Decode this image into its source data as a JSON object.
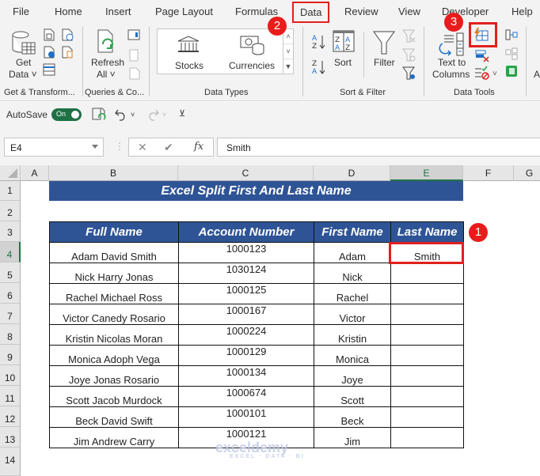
{
  "menu": {
    "tabs": [
      "File",
      "Home",
      "Insert",
      "Page Layout",
      "Formulas",
      "Data",
      "Review",
      "View",
      "Developer",
      "Help"
    ],
    "active_tab": "Data"
  },
  "ribbon": {
    "groups": {
      "get_transform": {
        "label": "Get & Transform...",
        "get_data_line1": "Get",
        "get_data_line2": "Data ˅"
      },
      "queries": {
        "label": "Queries & Co...",
        "refresh_line1": "Refresh",
        "refresh_line2": "All ˅"
      },
      "data_types": {
        "label": "Data Types",
        "stocks": "Stocks",
        "currencies": "Currencies"
      },
      "sort_filter": {
        "label": "Sort & Filter",
        "sort": "Sort",
        "filter": "Filter"
      },
      "data_tools": {
        "label": "Data Tools",
        "text_to_columns_line1": "Text to",
        "text_to_columns_line2": "Columns",
        "flash_fill": "Flash Fill"
      }
    },
    "overflow_letter": "A"
  },
  "qat": {
    "autosave_label": "AutoSave",
    "autosave_state": "On"
  },
  "formula_bar": {
    "name_box": "E4",
    "formula": "Smith",
    "fx": "fx",
    "cancel": "✕",
    "enter": "✔"
  },
  "grid": {
    "columns": [
      "A",
      "B",
      "C",
      "D",
      "E",
      "F",
      "G"
    ],
    "selected_column": "E",
    "rows": [
      "1",
      "2",
      "3",
      "4",
      "5",
      "6",
      "7",
      "8",
      "9",
      "10",
      "11",
      "12",
      "13",
      "14"
    ],
    "selected_row": "4"
  },
  "sheet": {
    "title": "Excel Split First And Last Name",
    "headers": [
      "Full Name",
      "Account Number",
      "First Name",
      "Last Name"
    ],
    "rows": [
      [
        "Adam David Smith",
        "1000123",
        "Adam",
        "Smith"
      ],
      [
        "Nick Harry Jonas",
        "1030124",
        "Nick",
        ""
      ],
      [
        "Rachel Michael Ross",
        "1000125",
        "Rachel",
        ""
      ],
      [
        "Victor Canedy Rosario",
        "1000167",
        "Victor",
        ""
      ],
      [
        "Kristin Nicolas Moran",
        "1000224",
        "Kristin",
        ""
      ],
      [
        "Monica Adoph Vega",
        "1000129",
        "Monica",
        ""
      ],
      [
        "Joye Jonas Rosario",
        "1000134",
        "Joye",
        ""
      ],
      [
        "Scott Jacob Murdock",
        "1000674",
        "Scott",
        ""
      ],
      [
        "Beck David Swift",
        "1000101",
        "Beck",
        ""
      ],
      [
        "Jim Andrew Carry",
        "1000121",
        "Jim",
        ""
      ]
    ]
  },
  "annotations": {
    "step1": "1",
    "step2": "2",
    "step3": "3",
    "color": "#e0201e"
  },
  "watermark": {
    "brand": "exceldemy",
    "tagline": "EXCEL · DATA · BI"
  }
}
